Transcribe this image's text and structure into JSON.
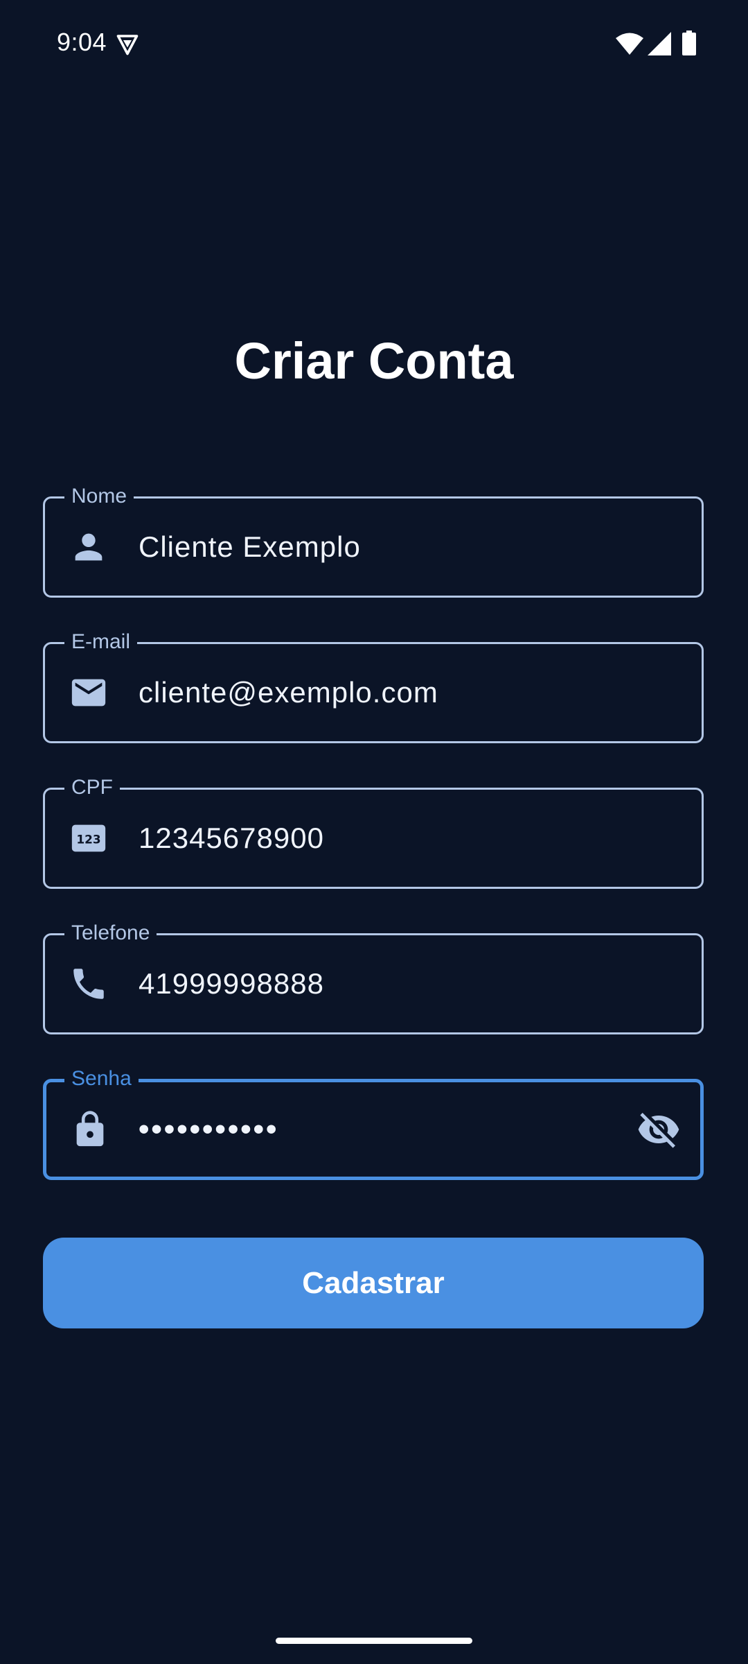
{
  "status_bar": {
    "time": "9:04",
    "icons": [
      "vpn-shield-icon",
      "wifi-icon",
      "cell-signal-icon",
      "battery-icon"
    ]
  },
  "title": "Criar Conta",
  "form": {
    "fields": [
      {
        "label": "Nome",
        "value": "Cliente Exemplo",
        "icon": "person-icon"
      },
      {
        "label": "E-mail",
        "value": "cliente@exemplo.com",
        "icon": "email-icon"
      },
      {
        "label": "CPF",
        "value": "12345678900",
        "icon": "numeric-123-icon"
      },
      {
        "label": "Telefone",
        "value": "41999998888",
        "icon": "phone-icon"
      },
      {
        "label": "Senha",
        "value": "•••••••••••",
        "icon": "lock-icon",
        "trailing_icon": "visibility-off-icon",
        "focused": true
      }
    ],
    "submit_label": "Cadastrar"
  },
  "colors": {
    "background": "#0b1427",
    "field_border": "#b3c7e6",
    "accent": "#4a90e2",
    "text": "#ffffff"
  }
}
